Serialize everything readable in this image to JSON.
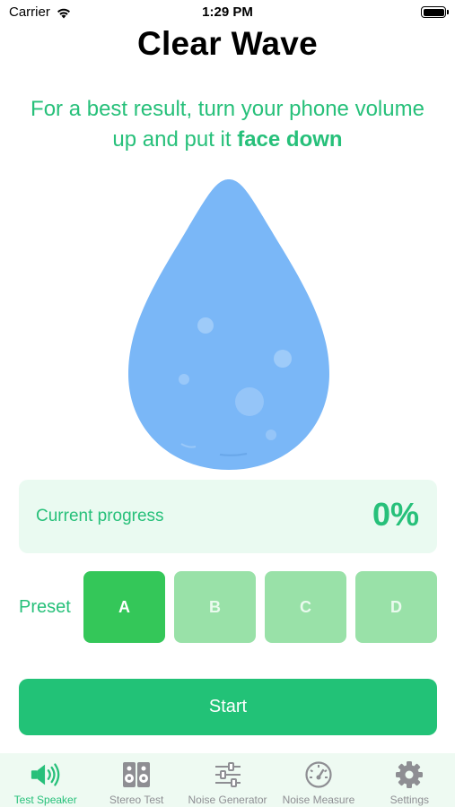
{
  "status_bar": {
    "carrier": "Carrier",
    "time": "1:29 PM"
  },
  "header": {
    "title": "Clear Wave"
  },
  "instruction": {
    "text_regular": "For a best result, turn your phone volume up and put it ",
    "text_bold": "face down"
  },
  "progress": {
    "label": "Current progress",
    "value": "0%"
  },
  "preset": {
    "label": "Preset",
    "options": [
      "A",
      "B",
      "C",
      "D"
    ],
    "selected": "A"
  },
  "start_button": {
    "label": "Start"
  },
  "tabbar": {
    "tabs": [
      {
        "label": "Test Speaker",
        "icon": "speaker-icon",
        "active": true
      },
      {
        "label": "Stereo Test",
        "icon": "stereo-speaker-icon",
        "active": false
      },
      {
        "label": "Noise Generator",
        "icon": "sliders-icon",
        "active": false
      },
      {
        "label": "Noise Measure",
        "icon": "gauge-icon",
        "active": false
      },
      {
        "label": "Settings",
        "icon": "gear-icon",
        "active": false
      }
    ]
  },
  "colors": {
    "accent": "#27c07a",
    "drop": "#7ab7f7",
    "preset_active": "#34c759",
    "preset_inactive": "#99e1a8",
    "tabbar_bg": "#eefaf2"
  }
}
